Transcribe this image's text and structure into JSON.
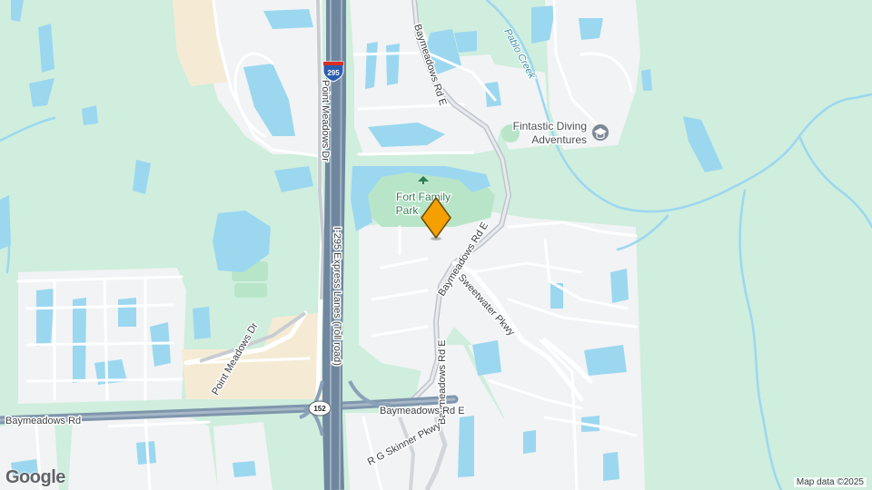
{
  "map": {
    "roads": {
      "baymeadows_rd": "Baymeadows Rd",
      "baymeadows_rd_e_lower": "Baymeadows Rd E",
      "baymeadows_rd_e_upper": "Baymeadows Rd E",
      "baymeadows_rd_e_north": "Baymeadows Rd E",
      "baymeadows_rd_e_mid": "Baymeadows Rd E",
      "point_meadows_dr_north": "Point Meadows Dr",
      "point_meadows_dr_south": "Point Meadows Dr",
      "i295_express": "I-295 Express Lanes (Toll road)",
      "sweetwater_pkwy": "Sweetwater Pkwy",
      "rg_skinner_pkwy": "R G Skinner Pkwy"
    },
    "shields": {
      "interstate": "295",
      "state_road": "152"
    },
    "water": {
      "pablo_creek": "Pablo Creek"
    },
    "places": {
      "park_line1": "Fort Family",
      "park_line2": "Park",
      "poi_line1": "Fintastic Diving",
      "poi_line2": "Adventures"
    },
    "icons": {
      "pin": "location-pin-icon",
      "poi": "school-icon",
      "park": "park-icon"
    },
    "colors": {
      "land": "#cfeedd",
      "urban": "#f1f3f4",
      "commercial": "#f7ecd6",
      "water": "#9cd7f0",
      "park": "#b8e5c8",
      "highway": "#8aa1b8",
      "pin": "#f5a000"
    }
  },
  "branding": {
    "logo": "Google",
    "attribution": "Map data ©2025"
  }
}
